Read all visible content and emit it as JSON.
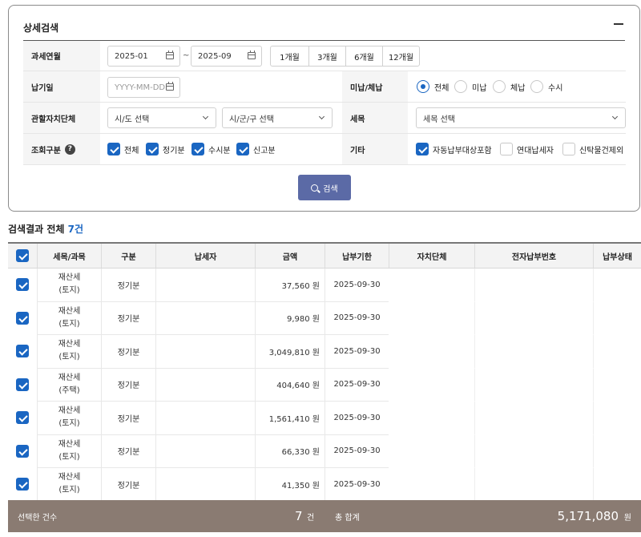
{
  "panel": {
    "title": "상세검색",
    "period_label": "과세연월",
    "period_from": "2025-01",
    "period_sep": "~",
    "period_to": "2025-09",
    "period_buttons": [
      "1개월",
      "3개월",
      "6개월",
      "12개월"
    ],
    "due_label": "납기일",
    "due_placeholder": "YYYY-MM-DD",
    "status_label": "미납/체납",
    "status_options": [
      "전체",
      "미납",
      "체납",
      "수시"
    ],
    "status_selected": "전체",
    "region_label": "관할자치단체",
    "sido_placeholder": "시/도 선택",
    "sigungu_placeholder": "시/군/구 선택",
    "taxtype_label": "세목",
    "taxtype_placeholder": "세목 선택",
    "query_label": "조회구분",
    "help_glyph": "?",
    "query_options": [
      "전체",
      "정기분",
      "수시분",
      "신고분"
    ],
    "etc_label": "기타",
    "etc_options": [
      {
        "label": "자동납부대상포함",
        "checked": true
      },
      {
        "label": "연대납세자",
        "checked": false
      },
      {
        "label": "신탁물건제외",
        "checked": false
      }
    ],
    "search_label": "검색"
  },
  "results": {
    "prefix": "검색결과 전체 ",
    "count": "7건",
    "columns": [
      "세목/과목",
      "구분",
      "납세자",
      "금액",
      "납부기한",
      "자치단체",
      "전자납부번호",
      "납부상태"
    ],
    "rows": [
      {
        "tax": "재산세",
        "sub": "(토지)",
        "type": "정기분",
        "amount": "37,560 원",
        "due": "2025-09-30",
        "checked": true
      },
      {
        "tax": "재산세",
        "sub": "(토지)",
        "type": "정기분",
        "amount": "9,980 원",
        "due": "2025-09-30",
        "checked": true
      },
      {
        "tax": "재산세",
        "sub": "(토지)",
        "type": "정기분",
        "amount": "3,049,810 원",
        "due": "2025-09-30",
        "checked": true
      },
      {
        "tax": "재산세",
        "sub": "(주택)",
        "type": "정기분",
        "amount": "404,640 원",
        "due": "2025-09-30",
        "checked": true
      },
      {
        "tax": "재산세",
        "sub": "(토지)",
        "type": "정기분",
        "amount": "1,561,410 원",
        "due": "2025-09-30",
        "checked": true
      },
      {
        "tax": "재산세",
        "sub": "(토지)",
        "type": "정기분",
        "amount": "66,330 원",
        "due": "2025-09-30",
        "checked": true
      },
      {
        "tax": "재산세",
        "sub": "(토지)",
        "type": "정기분",
        "amount": "41,350 원",
        "due": "2025-09-30",
        "checked": true
      }
    ]
  },
  "footer": {
    "selected_label": "선택한 건수",
    "selected_count": "7",
    "count_unit": "건",
    "total_label": "총 합계",
    "total_amount": "5,171,080",
    "amount_unit": "원"
  },
  "colors": {
    "accent": "#1a66c2",
    "search_button": "#5b6aa6",
    "footer_bg": "#8a7b72"
  }
}
